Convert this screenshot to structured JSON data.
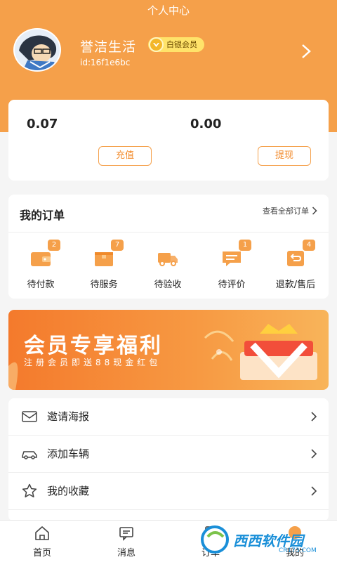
{
  "header": {
    "title": "个人中心",
    "user_name": "誉洁生活",
    "member_level": "白银会员",
    "user_id": "id:16f1e6bc"
  },
  "wallet": {
    "balance_left": "0.07",
    "balance_right": "0.00",
    "recharge_label": "充值",
    "withdraw_label": "提现"
  },
  "orders": {
    "title": "我的订单",
    "view_all": "查看全部订单",
    "items": [
      {
        "label": "待付款",
        "count": "2"
      },
      {
        "label": "待服务",
        "count": "7"
      },
      {
        "label": "待验收",
        "count": ""
      },
      {
        "label": "待评价",
        "count": "1"
      },
      {
        "label": "退款/售后",
        "count": "4"
      }
    ]
  },
  "banner": {
    "title": "会员专享福利",
    "subtitle": "注册会员即送88现金红包"
  },
  "menu": {
    "items": [
      {
        "label": "邀请海报",
        "icon": "envelope-icon"
      },
      {
        "label": "添加车辆",
        "icon": "car-icon"
      },
      {
        "label": "我的收藏",
        "icon": "star-icon"
      }
    ]
  },
  "tabbar": {
    "items": [
      {
        "label": "首页",
        "icon": "home-icon"
      },
      {
        "label": "消息",
        "icon": "message-icon"
      },
      {
        "label": "订单",
        "icon": "order-icon"
      },
      {
        "label": "我的",
        "icon": "profile-icon"
      }
    ]
  },
  "watermark": {
    "text": "西西软件园",
    "sub": "CR173.COM"
  },
  "colors": {
    "accent": "#f5a04a",
    "badge": "#ffe36a"
  }
}
